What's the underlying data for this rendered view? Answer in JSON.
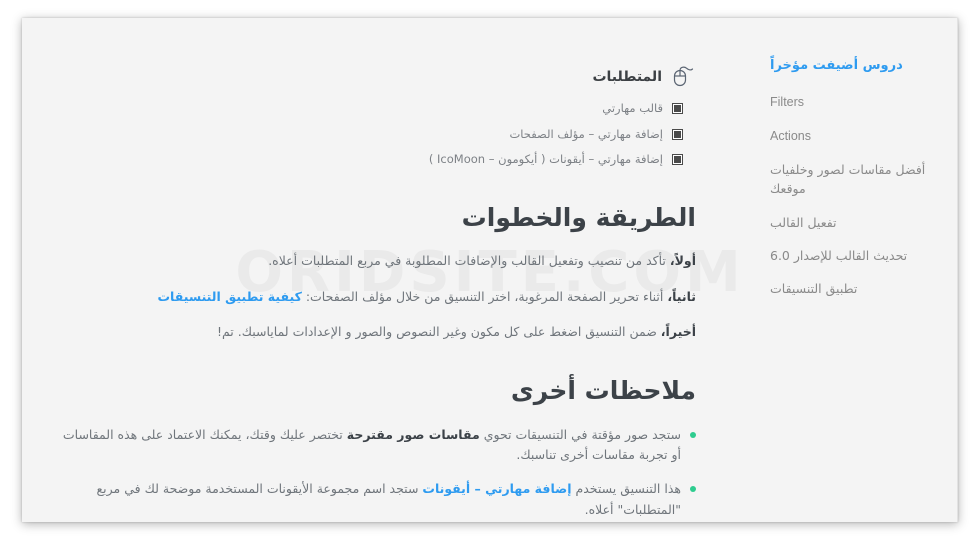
{
  "page": {
    "watermark": "ORIDSITE.COM"
  },
  "sidebar": {
    "items": [
      {
        "label": "دروس أضيفت مؤخراً",
        "active": true
      },
      {
        "label": "Filters",
        "active": false
      },
      {
        "label": "Actions",
        "active": false
      },
      {
        "label": "أفضل مقاسات لصور وخلفيات موقعك",
        "active": false
      },
      {
        "label": "تفعيل القالب",
        "active": false
      },
      {
        "label": "تحديث القالب للإصدار 6.0",
        "active": false
      },
      {
        "label": "تطبيق التنسيقات",
        "active": false
      }
    ]
  },
  "requirements": {
    "icon": "mouse-icon",
    "title": "المتطلبات",
    "items": [
      "قالب مهارتي",
      "إضافة مهارتي – مؤلف الصفحات",
      "إضافة مهارتي – أيقونات ( أيكومون – IcoMoon )"
    ]
  },
  "method": {
    "title": "الطريقة والخطوات",
    "steps": [
      {
        "lead": "أولاً،",
        "text": " تأكد من تنصيب وتفعيل القالب والإضافات المطلوبة في مربع المتطلبات أعلاه."
      },
      {
        "lead": "ثانياً،",
        "text": " أثناء تحرير الصفحة المرغوبة، اختر التنسيق من خلال مؤلف الصفحات: ",
        "link": "كيفية تطبيق التنسيقات",
        "tail": ""
      },
      {
        "lead": "أخيراً،",
        "text": " ضمن التنسيق اضغط على كل مكون وغير النصوص والصور و الإعدادات لماياسبك. تم!"
      }
    ]
  },
  "notes": {
    "title": "ملاحظات أخرى",
    "items": [
      {
        "pre": "ستجد صور مؤقتة في التنسيقات تحوي ",
        "bold": "مقاسات صور مقترحة",
        "post": " تختصر عليك وقتك، يمكنك الاعتماد على هذه المقاسات أو تجربة مقاسات أخرى تناسبك."
      },
      {
        "pre": "هذا التنسيق يستخدم ",
        "link": "إضافة مهارتي – أيقونات",
        "post": " ستجد اسم مجموعة الأيقونات المستخدمة موضحة لك في مربع \"المتطلبات\" أعلاه."
      }
    ]
  },
  "colors": {
    "accent_blue": "#2e9bf0",
    "accent_green": "#2ecc8f",
    "heading": "#3c4248",
    "body_text": "#6f757b",
    "page_bg": "#f4f4f4"
  }
}
